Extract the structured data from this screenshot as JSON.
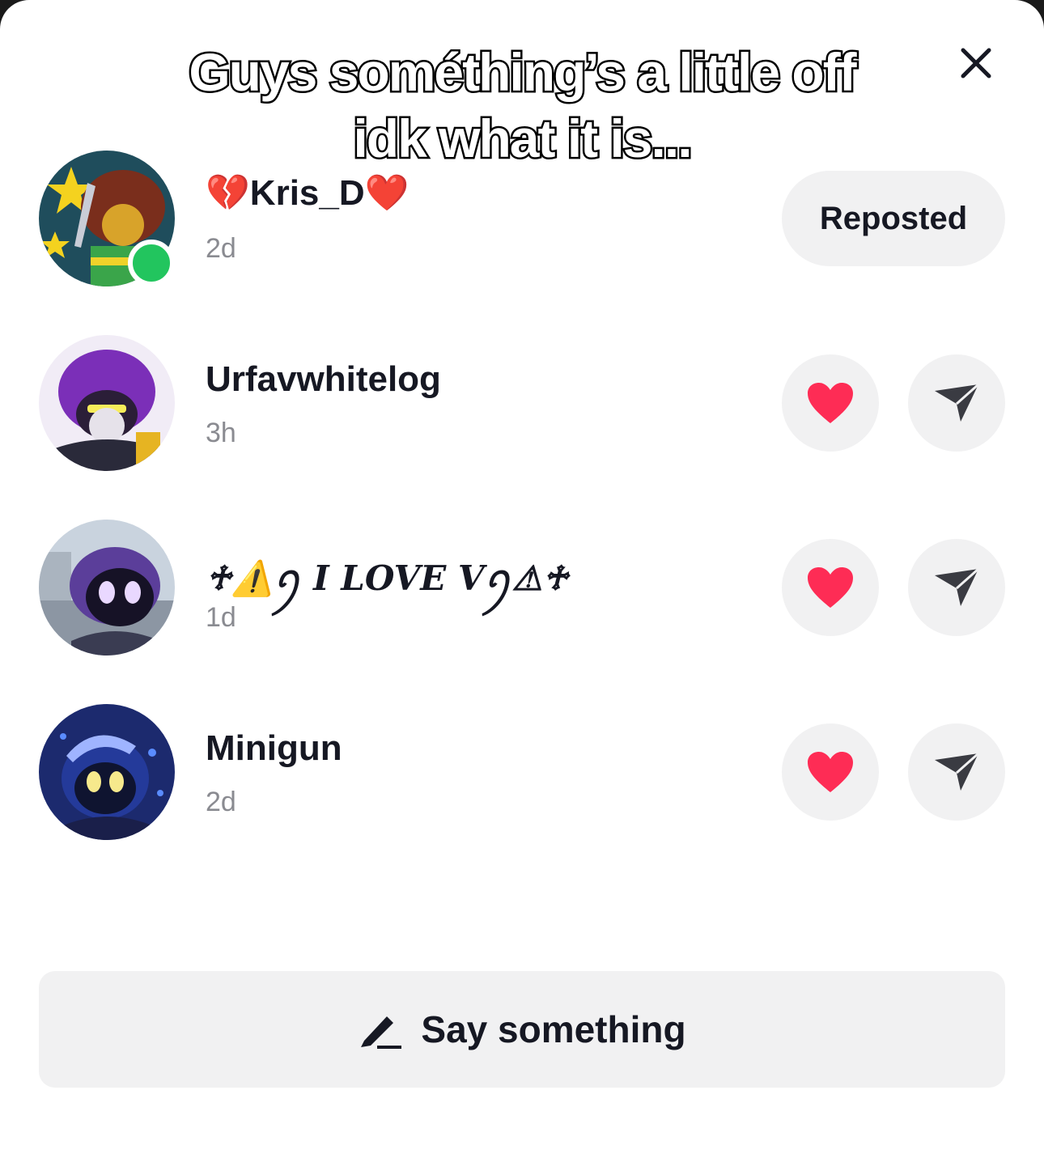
{
  "caption": {
    "line1": "Guys sométhing’s a little off",
    "line2": "idk what it is..."
  },
  "close_icon": "close-icon",
  "accent": {
    "online": "#22c55e",
    "heart": "#fe2c55",
    "button_bg": "#f1f1f2"
  },
  "reposts": [
    {
      "name_prefix": "💔",
      "name": "Kris_D",
      "name_suffix": "❤️",
      "time": "2d",
      "action": "Reposted",
      "online": true
    },
    {
      "name": "Urfavwhitelog",
      "time": "3h"
    },
    {
      "name": "♱⚠️ꪆ I LOVE Vꪆ⚠♱",
      "time": "1d"
    },
    {
      "name": "Minigun",
      "time": "2d"
    }
  ],
  "composer": {
    "label": "Say something",
    "icon": "pencil-icon"
  }
}
